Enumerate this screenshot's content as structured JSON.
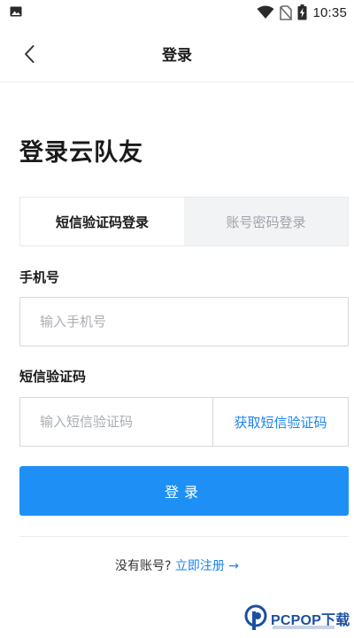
{
  "status_bar": {
    "time": "10:35",
    "icons": [
      "image-icon",
      "wifi-icon",
      "no-sim-icon",
      "battery-charging-icon"
    ]
  },
  "nav": {
    "back_icon": "chevron-left-icon",
    "title": "登录"
  },
  "heading": "登录云队友",
  "tabs": [
    {
      "label": "短信验证码登录",
      "active": true
    },
    {
      "label": "账号密码登录",
      "active": false
    }
  ],
  "phone": {
    "label": "手机号",
    "placeholder": "输入手机号",
    "value": ""
  },
  "sms_code": {
    "label": "短信验证码",
    "placeholder": "输入短信验证码",
    "value": "",
    "get_code_label": "获取短信验证码"
  },
  "login_button": "登录",
  "register": {
    "question": "没有账号?",
    "link_label": "立即注册 →"
  },
  "watermark": {
    "brand": "PCPOP下载"
  },
  "colors": {
    "accent": "#1e90f5",
    "link": "#1a83f0",
    "tab_inactive_bg": "#f2f3f5"
  }
}
